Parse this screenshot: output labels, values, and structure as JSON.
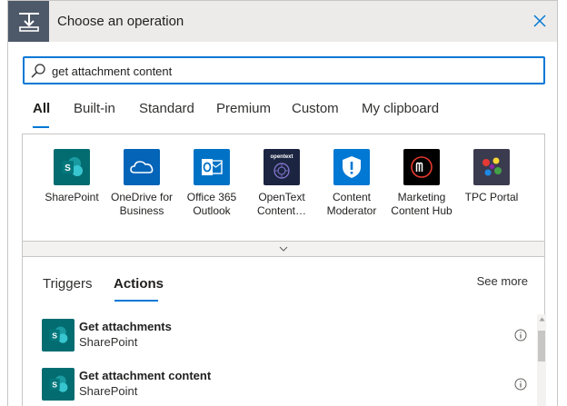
{
  "header": {
    "title": "Choose an operation",
    "icon": "operation-icon",
    "close_icon": "close-icon"
  },
  "search": {
    "value": "get attachment content",
    "icon": "search-icon"
  },
  "tabs": [
    {
      "label": "All",
      "active": true
    },
    {
      "label": "Built-in",
      "active": false
    },
    {
      "label": "Standard",
      "active": false
    },
    {
      "label": "Premium",
      "active": false
    },
    {
      "label": "Custom",
      "active": false
    },
    {
      "label": "My clipboard",
      "active": false
    }
  ],
  "connectors": [
    {
      "name": "SharePoint",
      "color": "#036c70",
      "icon": "sharepoint-icon"
    },
    {
      "name": "OneDrive for Business",
      "color": "#0364b8",
      "icon": "onedrive-icon"
    },
    {
      "name": "Office 365 Outlook",
      "color": "#0072c6",
      "icon": "outlook-icon"
    },
    {
      "name": "OpenText Content…",
      "color": "#1b2541",
      "icon": "opentext-icon",
      "logo_text": "opentext"
    },
    {
      "name": "Content Moderator",
      "color": "#0078d4",
      "icon": "shield-icon"
    },
    {
      "name": "Marketing Content Hub",
      "color": "#000000",
      "icon": "marketing-hub-icon"
    },
    {
      "name": "TPC Portal",
      "color": "#3b3b4f",
      "icon": "tpc-portal-icon"
    }
  ],
  "expand_icon": "chevron-down-icon",
  "subtabs": [
    {
      "label": "Triggers",
      "active": false
    },
    {
      "label": "Actions",
      "active": true
    }
  ],
  "see_more": "See more",
  "actions": [
    {
      "title": "Get attachments",
      "connector": "SharePoint",
      "icon": "sharepoint-icon",
      "info_icon": "info-icon"
    },
    {
      "title": "Get attachment content",
      "connector": "SharePoint",
      "icon": "sharepoint-icon",
      "info_icon": "info-icon"
    }
  ],
  "colors": {
    "accent": "#0078d4",
    "header_bg": "#edebe9",
    "header_icon_bg": "#4d5868",
    "sharepoint": "#036c70"
  }
}
